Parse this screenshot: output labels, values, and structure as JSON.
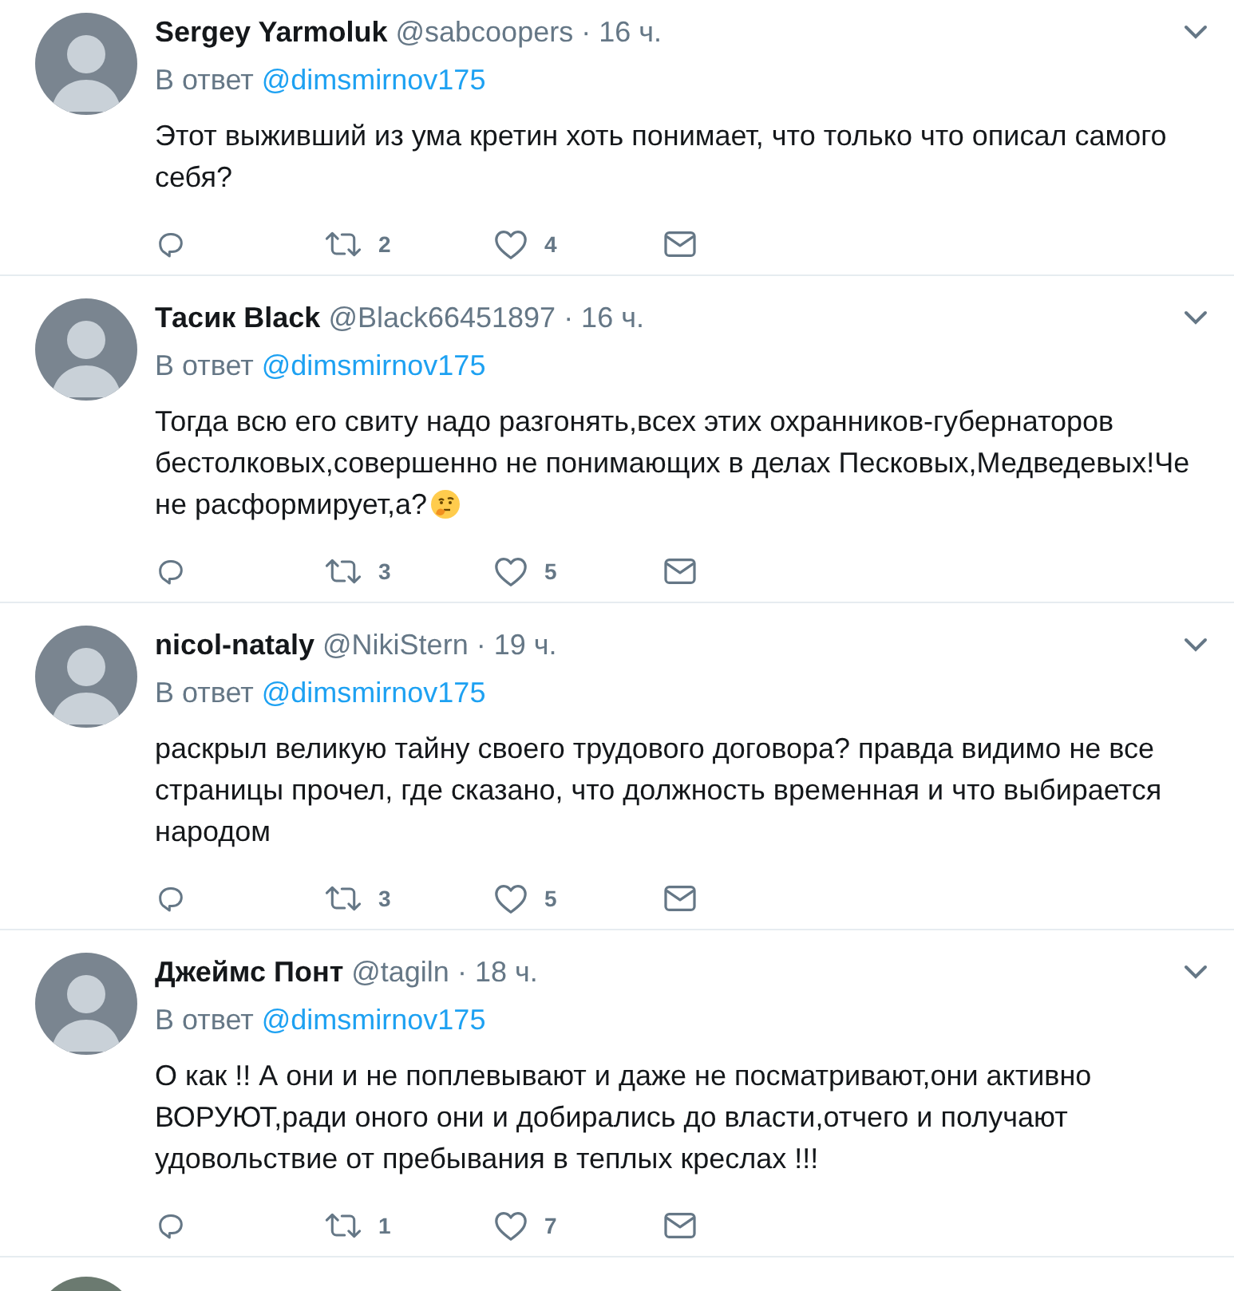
{
  "tweets": [
    {
      "name": "Sergey Yarmoluk",
      "handle": "@sabcoopers",
      "time": "· 16 ч.",
      "reply_prefix": "В ответ",
      "reply_to": "@dimsmirnov175",
      "text": "Этот выживший из ума кретин хоть понимает, что только что описал самого себя?",
      "emoji": false,
      "retweets": "2",
      "likes": "4"
    },
    {
      "name": "Тасик Black",
      "handle": "@Black66451897",
      "time": "· 16 ч.",
      "reply_prefix": "В ответ",
      "reply_to": "@dimsmirnov175",
      "text": "Тогда всю его свиту надо разгонять,всех этих охранников-губернаторов бестолковых,совершенно не понимающих в делах Песковых,Медведевых!Че не расформирует,а?",
      "emoji": true,
      "retweets": "3",
      "likes": "5"
    },
    {
      "name": "nicol-nataly",
      "handle": "@NikiStern",
      "time": "· 19 ч.",
      "reply_prefix": "В ответ",
      "reply_to": "@dimsmirnov175",
      "text": "раскрыл великую тайну своего трудового договора? правда видимо не все страницы прочел, где сказано, что должность временная и что выбирается народом",
      "emoji": false,
      "retweets": "3",
      "likes": "5"
    },
    {
      "name": "Джеймс Понт",
      "handle": "@tagiln",
      "time": "· 18 ч.",
      "reply_prefix": "В ответ",
      "reply_to": "@dimsmirnov175",
      "text": "О как !! А они и не поплевывают и даже не посматривают,они активно ВОРУЮТ,ради оного они и добирались до власти,отчего и получают удовольствие от пребывания в теплых креслах !!!",
      "emoji": false,
      "retweets": "1",
      "likes": "7"
    }
  ]
}
